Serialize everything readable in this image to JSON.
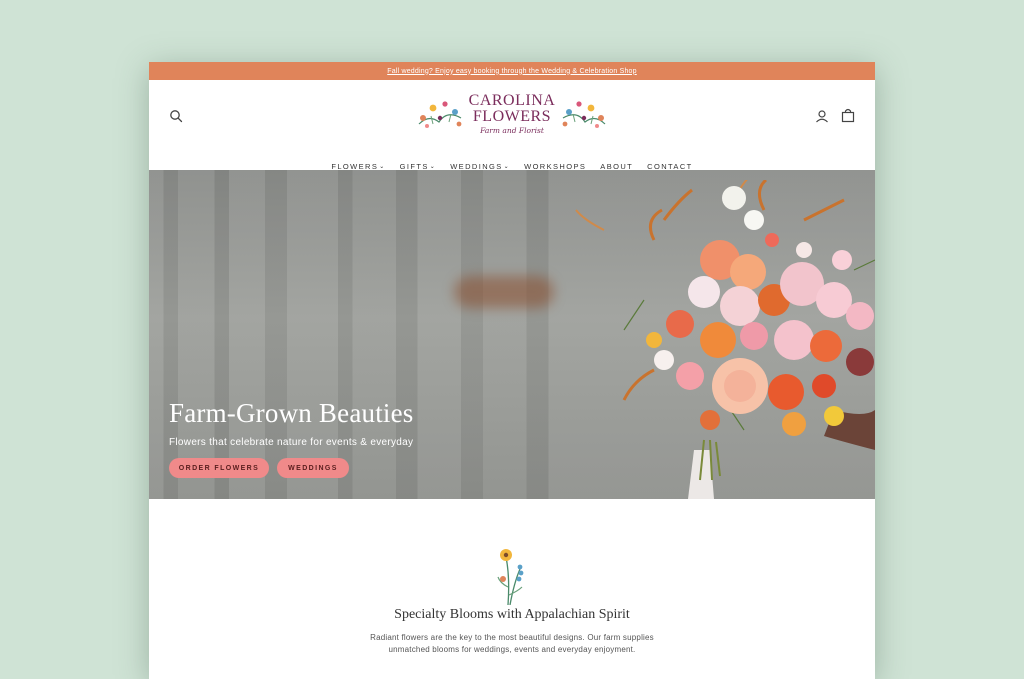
{
  "announcement": {
    "text": "Fall wedding? Enjoy easy booking through the Wedding & Celebration Shop"
  },
  "header": {
    "logo": {
      "line1": "CAROLINA",
      "line2": "FLOWERS",
      "tagline": "Farm and Florist"
    },
    "icons": [
      "search-icon",
      "account-icon",
      "cart-icon"
    ]
  },
  "nav": {
    "items": [
      {
        "label": "FLOWERS",
        "dropdown": true
      },
      {
        "label": "GIFTS",
        "dropdown": true
      },
      {
        "label": "WEDDINGS",
        "dropdown": true
      },
      {
        "label": "WORKSHOPS",
        "dropdown": false
      },
      {
        "label": "ABOUT",
        "dropdown": false
      },
      {
        "label": "CONTACT",
        "dropdown": false
      }
    ],
    "chevron": "⌄"
  },
  "hero": {
    "title": "Farm-Grown Beauties",
    "subtitle": "Flowers that celebrate nature for events & everyday",
    "buttons": {
      "order": "ORDER FLOWERS",
      "weddings": "WEDDINGS"
    }
  },
  "intro": {
    "title": "Specialty Blooms with Appalachian Spirit",
    "body": "Radiant flowers are the key to the most beautiful designs. Our farm supplies unmatched blooms for weddings, events and everyday enjoyment."
  },
  "colors": {
    "background": "#cfe3d5",
    "announcement_bar": "#e0845a",
    "brand": "#7b2d5c",
    "button": "#f08a8a"
  }
}
